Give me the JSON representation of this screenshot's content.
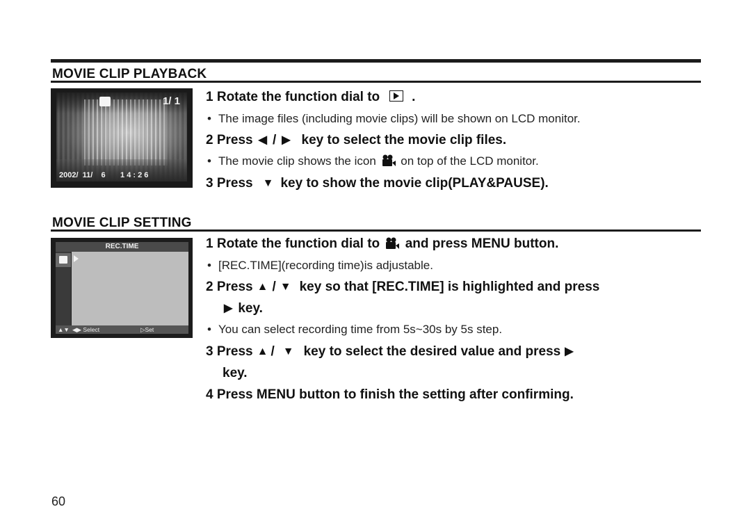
{
  "sections": {
    "playback": {
      "title": "MOVIE CLIP PLAYBACK",
      "lcd": {
        "counter": "1/  1",
        "datetime": "2002/  11/    6       1 4 : 2 6"
      },
      "step1": {
        "text": "1 Rotate the function dial to",
        "icon": "playback-mode-icon",
        "suffix": "."
      },
      "bullet1": "The image files (including movie clips) will be shown on LCD monitor.",
      "step2": {
        "prefix": "2 Press",
        "left_key": "◀",
        "sep": "/",
        "right_key": "▶",
        "suffix": "key to select the movie clip files."
      },
      "bullet2": {
        "prefix": "The movie clip shows the icon",
        "icon": "movie-camera-icon",
        "suffix": "on top of the LCD monitor."
      },
      "step3": {
        "prefix": "3 Press",
        "key": "▼",
        "suffix": "key to show the movie clip(PLAY&PAUSE)."
      }
    },
    "setting": {
      "title": "MOVIE CLIP SETTING",
      "lcd": {
        "menu_title": "REC.TIME",
        "footer_nav": "▲▼",
        "footer_select": "◀▶ Select",
        "footer_set": "▷Set"
      },
      "step1": {
        "prefix": "1 Rotate the function dial to",
        "icon": "movie-camera-icon",
        "suffix": "and press MENU button."
      },
      "bullet1": "[REC.TIME](recording time)is adjustable.",
      "step2": {
        "prefix": "2 Press",
        "up_key": "▲",
        "sep": "/",
        "down_key": "▼",
        "suffix": "key so that [REC.TIME] is highlighted and press",
        "line2_key": "▶",
        "line2_suffix": "key."
      },
      "bullet2": "You can select recording time from 5s~30s by 5s step.",
      "step3": {
        "prefix": "3 Press",
        "up_key": "▲",
        "sep": "/",
        "down_key": "▼",
        "suffix": "key to select the desired value and press",
        "right_key": "▶",
        "line2": "key."
      },
      "step4": "4 Press MENU button to finish the setting after confirming."
    }
  },
  "bullet_char": "•",
  "page_number": "60"
}
